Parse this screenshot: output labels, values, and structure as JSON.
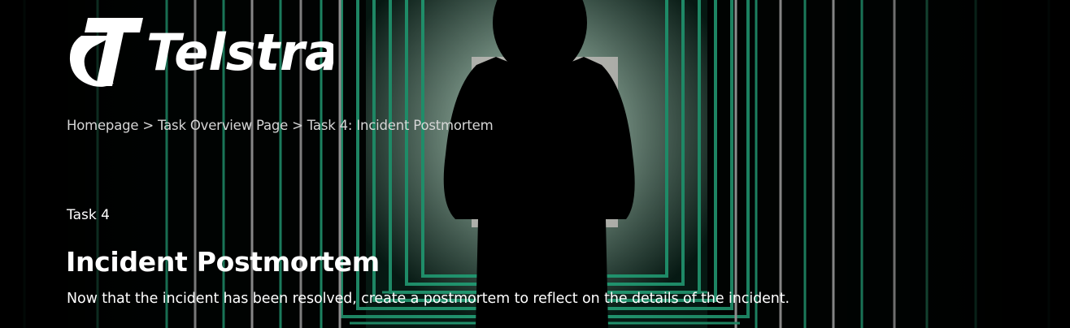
{
  "brand": {
    "logo_text": "Telstra"
  },
  "breadcrumb": {
    "items": [
      "Homepage",
      "Task Overview Page",
      "Task 4: Incident Postmortem"
    ],
    "separator": ">"
  },
  "task": {
    "label": "Task 4",
    "title": "Incident Postmortem",
    "description": "Now that the incident has been resolved, create a postmortem to reflect on the details of the incident."
  },
  "colors": {
    "accent_green": "#2ecf9a",
    "background": "#000000",
    "text": "#ffffff"
  },
  "icons": {
    "logo": "telstra-logo-icon"
  }
}
